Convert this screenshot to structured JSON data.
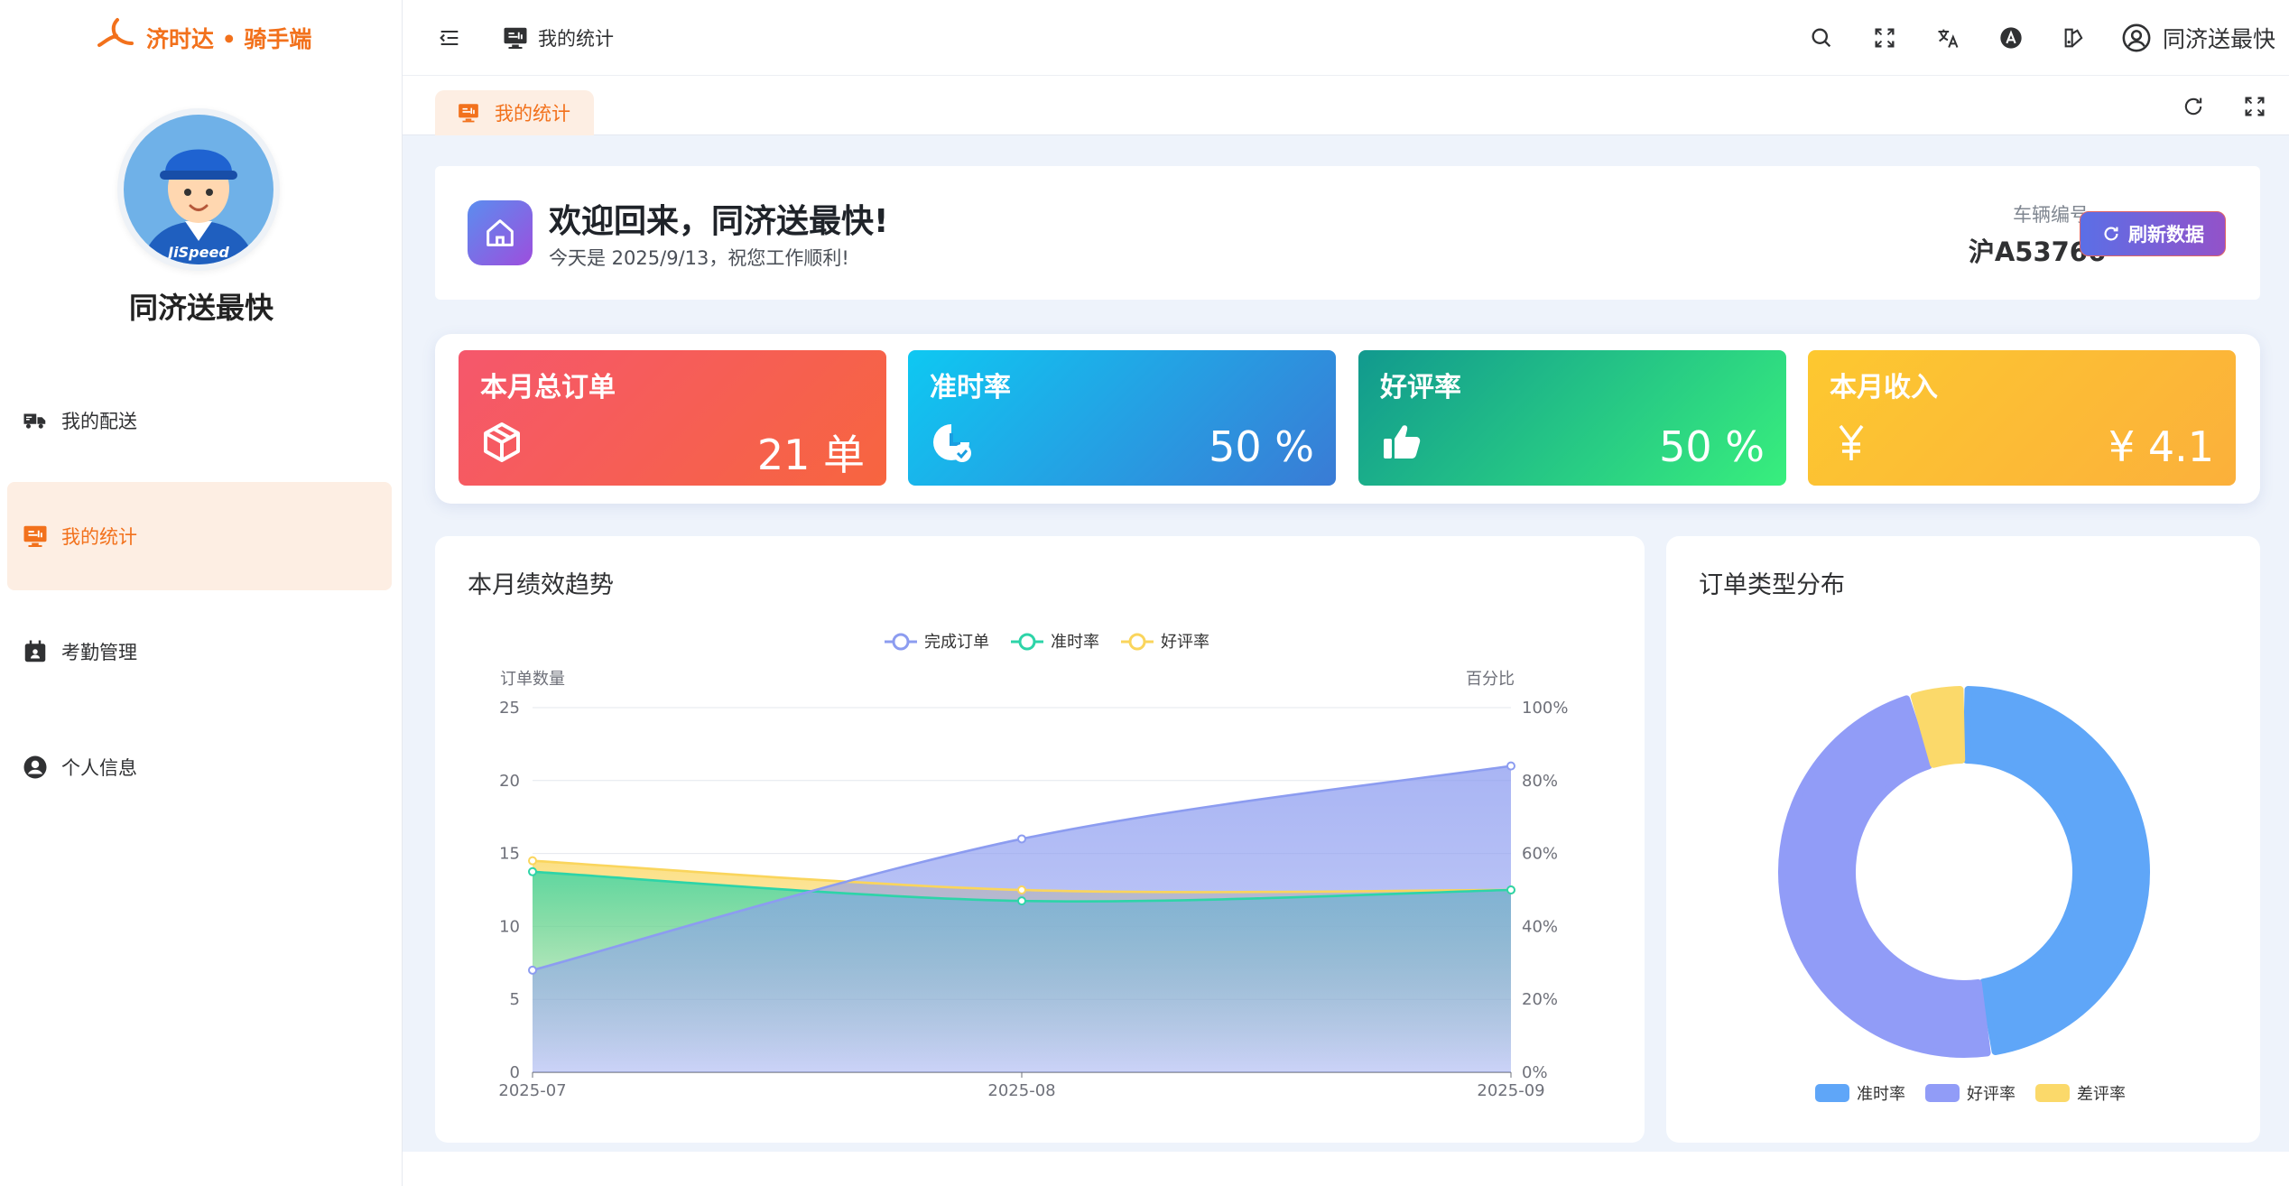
{
  "sidebar": {
    "brand": "济时达 • 骑手端",
    "avatar_text": "JiSpeed",
    "user_name": "同济送最快",
    "items": [
      {
        "label": "我的配送",
        "icon": "delivery-truck-icon"
      },
      {
        "label": "我的统计",
        "icon": "monitor-chart-icon",
        "active": true
      },
      {
        "label": "考勤管理",
        "icon": "attendance-calendar-icon"
      },
      {
        "label": "个人信息",
        "icon": "user-circle-icon"
      }
    ]
  },
  "header": {
    "breadcrumb": "我的统计",
    "user_name": "同济送最快",
    "icons": [
      "menu-fold-icon",
      "search-icon",
      "fullscreen-icon",
      "translate-icon",
      "font-a-icon",
      "theme-icon",
      "user-circle-icon"
    ]
  },
  "tabs": [
    {
      "label": "我的统计",
      "active": true
    }
  ],
  "welcome": {
    "title": "欢迎回来，同济送最快!",
    "subtitle": "今天是 2025/9/13，祝您工作顺利!",
    "vehicle_label": "车辆编号",
    "vehicle_no": "沪A53766",
    "refresh_label": "刷新数据"
  },
  "stats": [
    {
      "label": "本月总订单",
      "value": "21 单",
      "icon": "box-icon",
      "color_from": "#f5576c",
      "color_to": "#f7653f"
    },
    {
      "label": "准时率",
      "value": "50 %",
      "icon": "clock-check-icon",
      "color_from": "#0ec8f2",
      "color_to": "#3a7bd5"
    },
    {
      "label": "好评率",
      "value": "50 %",
      "icon": "thumbs-up-icon",
      "color_from": "#11998e",
      "color_to": "#38ef7d"
    },
    {
      "label": "本月收入",
      "value": "¥ 4.1",
      "icon": "yen-icon",
      "color_from": "#fdc830",
      "color_to": "#fbb03b"
    }
  ],
  "trend_title": "本月绩效趋势",
  "pie_title": "订单类型分布",
  "chart_data": [
    {
      "type": "line",
      "x": [
        "2025-07",
        "2025-08",
        "2025-09"
      ],
      "ylabel": "订单数量",
      "y2label": "百分比",
      "ylim": [
        0,
        25
      ],
      "y_ticks": [
        "0",
        "5",
        "10",
        "15",
        "20",
        "25"
      ],
      "y2lim": [
        0,
        100
      ],
      "y2_ticks": [
        "0%",
        "20%",
        "40%",
        "60%",
        "80%",
        "100%"
      ],
      "legend_position": "top-center",
      "series": [
        {
          "name": "完成订单",
          "axis": "left",
          "values": [
            7,
            16,
            21
          ],
          "color": "#8c9cf0"
        },
        {
          "name": "准时率",
          "axis": "right",
          "values": [
            55,
            47,
            50
          ],
          "color": "#2dd4a8"
        },
        {
          "name": "好评率",
          "axis": "right",
          "values": [
            58,
            50,
            50
          ],
          "color": "#fad55c"
        }
      ]
    },
    {
      "type": "pie",
      "donut": true,
      "legend_position": "bottom-center",
      "series": [
        {
          "name": "准时率",
          "value": 50,
          "color": "#5fa6f8"
        },
        {
          "name": "好评率",
          "value": 50,
          "color": "#919cf7"
        },
        {
          "name": "差评率",
          "value": 5,
          "color": "#fbd96a"
        }
      ]
    }
  ]
}
